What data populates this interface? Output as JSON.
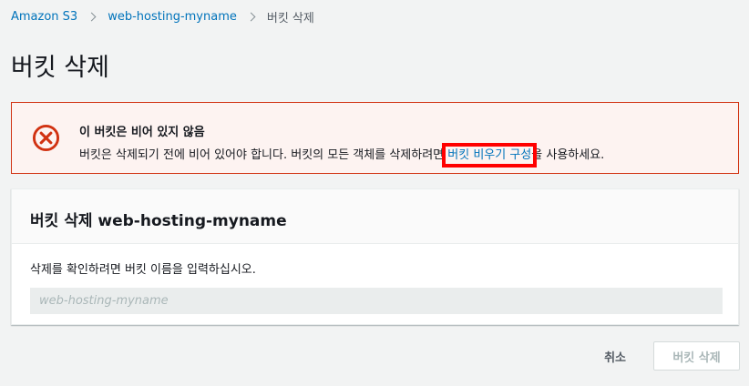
{
  "breadcrumb": {
    "items": [
      "Amazon S3",
      "web-hosting-myname"
    ],
    "current": "버킷 삭제"
  },
  "page": {
    "title": "버킷 삭제"
  },
  "alert": {
    "type": "error",
    "icon": "x-circle-icon",
    "title": "이 버킷은 비어 있지 않음",
    "text_before": "버킷은 삭제되기 전에 비어 있어야 합니다. 버킷의 모든 객체를 삭제하려면 ",
    "link": "버킷 비우기 구성",
    "text_after": "을 사용하세요.",
    "color": "#d13212"
  },
  "panel": {
    "title": "버킷 삭제 web-hosting-myname",
    "field_label": "삭제를 확인하려면 버킷 이름을 입력하십시오.",
    "input_placeholder": "web-hosting-myname",
    "input_value": ""
  },
  "actions": {
    "cancel": "취소",
    "delete": "버킷 삭제"
  },
  "colors": {
    "link": "#0073bb",
    "error": "#d13212",
    "highlight": "#ff0000"
  }
}
